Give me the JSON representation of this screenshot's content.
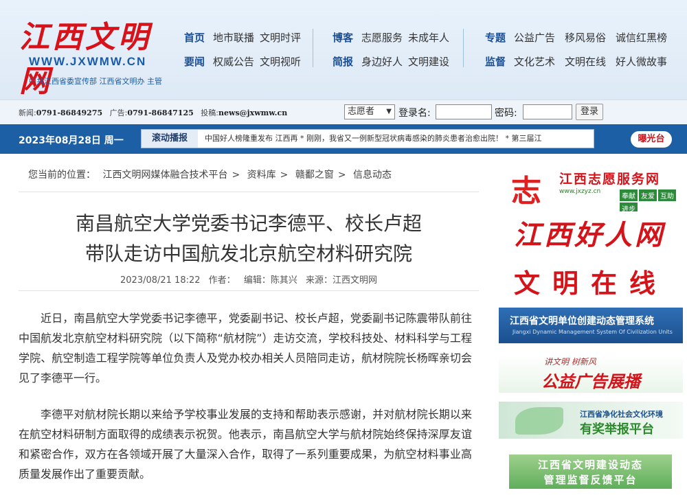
{
  "header": {
    "logo_text": "江西文明网",
    "logo_url": "WWW.JXWMW.CN",
    "logo_sub": "中共江西省委宣传部  江西省文明办 主管",
    "nav": [
      {
        "key": "首页",
        "items": [
          "地市联播",
          "文明时评"
        ]
      },
      {
        "key": "要闻",
        "items": [
          "权威公告",
          "文明视听"
        ]
      },
      {
        "key": "博客",
        "items": [
          "志愿服务",
          "未成年人"
        ]
      },
      {
        "key": "简报",
        "items": [
          "身边好人",
          "文明建设"
        ]
      },
      {
        "key": "专题",
        "items": [
          "公益广告",
          "移风易俗",
          "诚信红黑榜"
        ]
      },
      {
        "key": "监督",
        "items": [
          "文化艺术",
          "文明在线",
          "好人微故事"
        ]
      }
    ]
  },
  "loginbar": {
    "news_label": "新闻:",
    "news_phone": "0791-86849275",
    "ad_label": "广告:",
    "ad_phone": "0791-86847125",
    "email_label": "投稿:",
    "email": "news@jxwmw.cn",
    "role_select": "志愿者",
    "login_name_label": "登录名:",
    "password_label": "密码:",
    "login_button": "登录"
  },
  "datebar": {
    "date": "2023年08月28日 周一",
    "ticker_tag": "滚动播报",
    "ticker_text": "中国好人榜隆重发布 江西再 * 刚刚，我省又一例新型冠状病毒感染的肺炎患者治愈出院！ * 第三届江",
    "expose_button": "曝光台"
  },
  "article": {
    "breadcrumb_label": "您当前的位置：",
    "breadcrumb": [
      "江西文明网媒体融合技术平台",
      "资料库",
      "赣鄱之窗",
      "信息动态"
    ],
    "title_line1": "南昌航空大学党委书记李德平、校长卢超",
    "title_line2": "带队走访中国航发北京航空材料研究院",
    "datetime": "2023/08/21 18:22",
    "author_label": "作者：",
    "editor": "编辑：陈其兴",
    "source": "来源：江西文明网",
    "paragraph1": "近日，南昌航空大学党委书记李德平，党委副书记、校长卢超，党委副书记陈震带队前往中国航发北京航空材料研究院（以下简称“航材院”）走访交流，学校科技处、材料科学与工程学院、航空制造工程学院等单位负责人及党办校办相关人员陪同走访，航材院院长杨晖亲切会见了李德平一行。",
    "paragraph2": "李德平对航材院长期以来给予学校事业发展的支持和帮助表示感谢，并对航材院长期以来在航空材料研制方面取得的成绩表示祝贺。他表示，南昌航空大学与航材院始终保持深厚友谊和紧密合作，双方在各领域开展了大量深入合作，取得了一系列重要成果，为航空材料事业高质量发展作出了重要贡献。"
  },
  "sidebar": {
    "volunteer": {
      "glyph": "志",
      "title": "江西志愿服务网",
      "url": "www.jxzyz.cn",
      "tags": [
        "奉献",
        "友爱",
        "互助",
        "进步"
      ]
    },
    "good_people": "江西好人网",
    "civilization_online": "文明在线",
    "dynamic_mgmt": {
      "title": "江西省文明单位创建动态管理系统",
      "sub": "Jiangxi Dynamic Management System Of Civilization Units"
    },
    "public_ad": {
      "sub": "讲文明  树新风",
      "title": "公益广告展播"
    },
    "report": {
      "sub": "江西省净化社会文化环境",
      "title": "有奖举报平台"
    },
    "feedback": {
      "line1": "江西省文明建设动态",
      "line2": "管理监督反馈平台"
    }
  }
}
